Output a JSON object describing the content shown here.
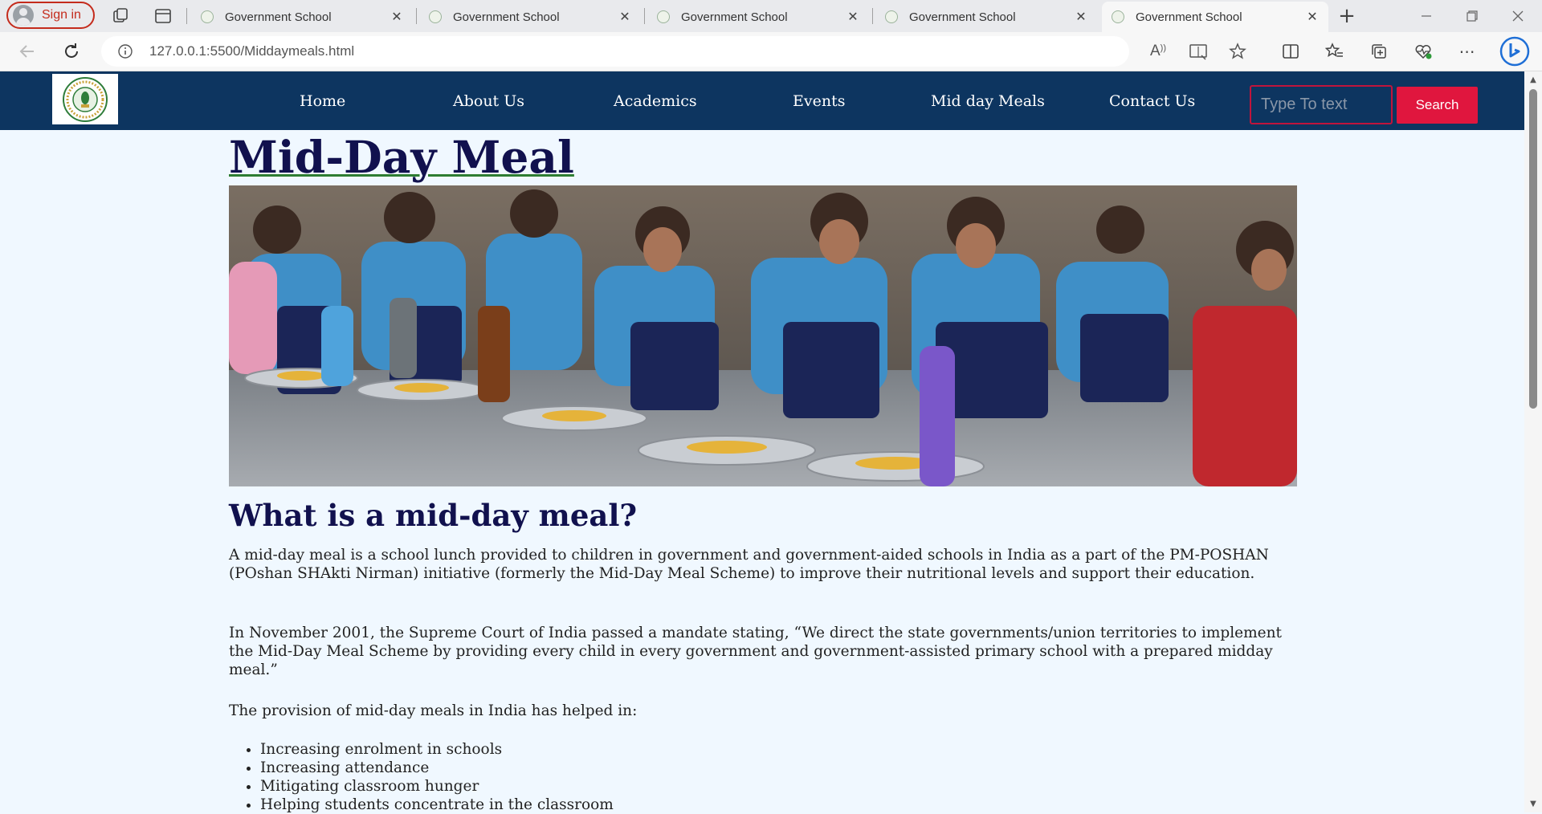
{
  "browser": {
    "signin_label": "Sign in",
    "tabs": [
      {
        "title": "Government School"
      },
      {
        "title": "Government School"
      },
      {
        "title": "Government School"
      },
      {
        "title": "Government School"
      },
      {
        "title": "Government School"
      }
    ],
    "active_tab": 4,
    "new_tab_symbol": "+",
    "url": "127.0.0.1:5500/Middaymeals.html",
    "read_aloud_label": "A"
  },
  "site": {
    "nav": {
      "links": [
        "Home",
        "About Us",
        "Academics",
        "Events",
        "Mid day Meals",
        "Contact Us"
      ],
      "search_placeholder": "Type To text",
      "search_button": "Search"
    },
    "page_title": "Mid-Day Meal",
    "section_heading": "What is a mid-day meal?",
    "paragraphs": [
      "A mid-day meal is a school lunch provided to children in government and government-aided schools in India as a part of the PM-POSHAN (POshan SHAkti Nirman) initiative (formerly the Mid-Day Meal Scheme) to improve their nutritional levels and support their education.",
      "In November 2001, the Supreme Court of India passed a mandate stating, “We direct the state governments/union territories to implement the Mid-Day Meal Scheme by providing every child in every government and government-assisted primary school with a prepared midday meal.”",
      "The provision of mid-day meals in India has helped in:"
    ],
    "benefits": [
      "Increasing enrolment in schools",
      "Increasing attendance",
      "Mitigating classroom hunger",
      "Helping students concentrate in the classroom"
    ]
  },
  "colors": {
    "nav_background": "#0d3560",
    "search_button": "#e0163e",
    "heading": "#11114e",
    "page_background": "#f0f8ff",
    "title_underline": "#2e7d32"
  }
}
